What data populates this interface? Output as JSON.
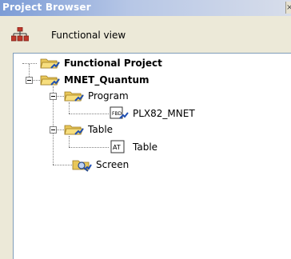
{
  "window": {
    "title": "Project Browser"
  },
  "header": {
    "view_label": "Functional view",
    "view_icon": "functional-view-icon"
  },
  "tree": {
    "root": {
      "label": "Functional Project",
      "icon": "folder-open-icon"
    },
    "project": {
      "label": "MNET_Quantum",
      "icon": "folder-open-icon",
      "expanded": true
    },
    "program": {
      "label": "Program",
      "icon": "folder-open-icon",
      "expanded": true
    },
    "program_item": {
      "label": "PLX82_MNET",
      "icon": "fbd-section-icon"
    },
    "table": {
      "label": "Table",
      "icon": "folder-open-icon",
      "expanded": true
    },
    "table_item": {
      "label": "Table",
      "icon": "animation-table-icon"
    },
    "screen": {
      "label": "Screen",
      "icon": "screen-folder-icon"
    }
  }
}
